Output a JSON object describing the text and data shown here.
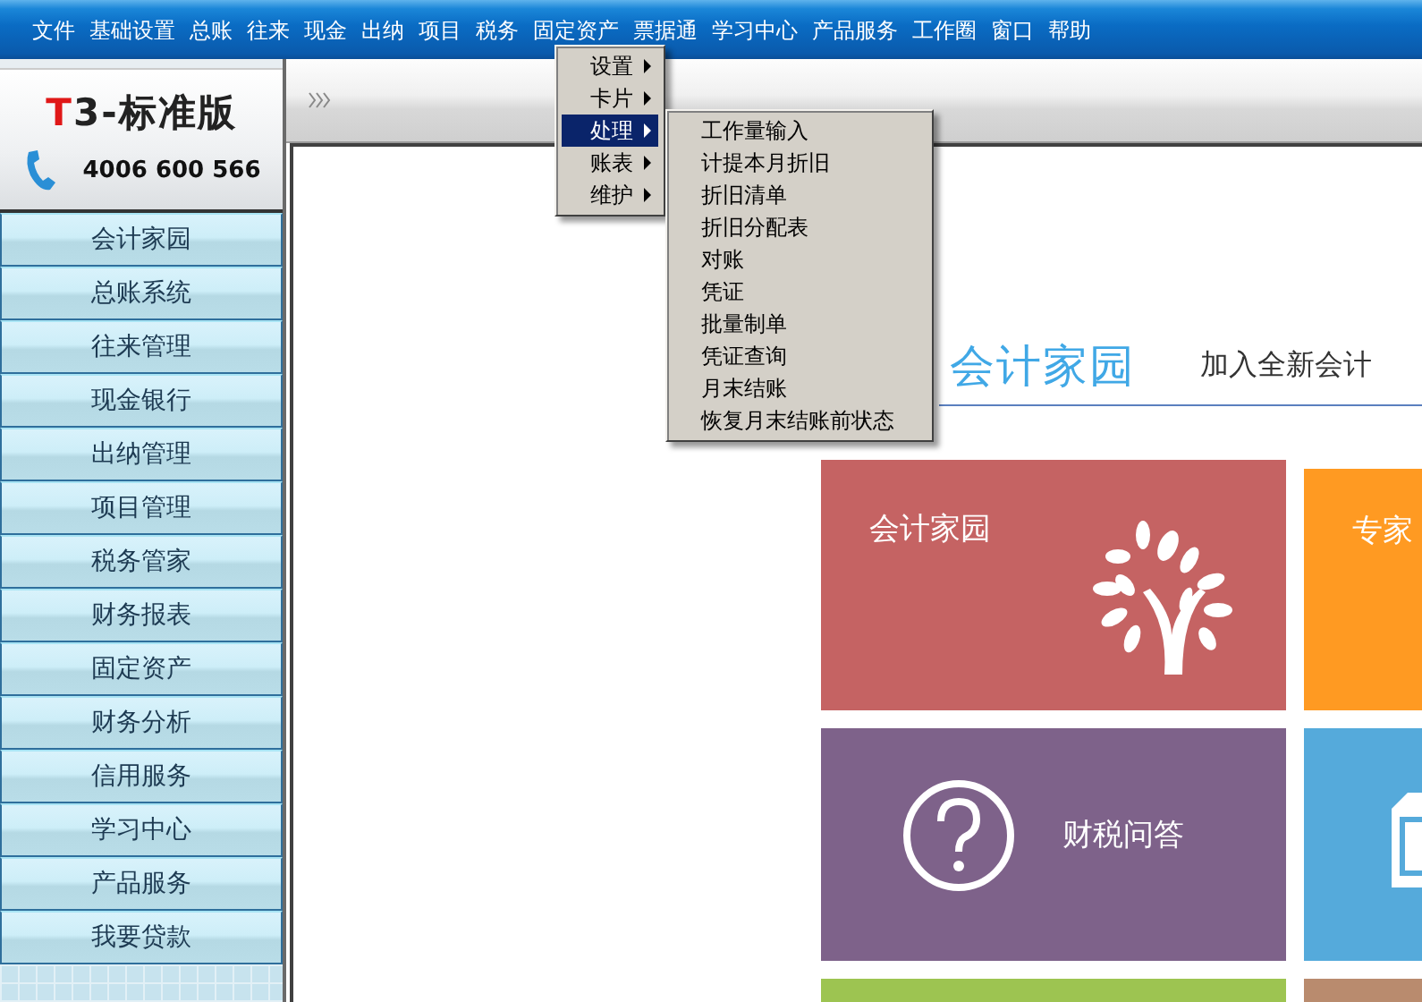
{
  "menubar": [
    "文件",
    "基础设置",
    "总账",
    "往来",
    "现金",
    "出纳",
    "项目",
    "税务",
    "固定资产",
    "票据通",
    "学习中心",
    "产品服务",
    "工作圈",
    "窗口",
    "帮助"
  ],
  "context_menu": {
    "items": [
      {
        "label": "设置",
        "submenu": true,
        "selected": false
      },
      {
        "label": "卡片",
        "submenu": true,
        "selected": false
      },
      {
        "label": "处理",
        "submenu": true,
        "selected": true
      },
      {
        "label": "账表",
        "submenu": true,
        "selected": false
      },
      {
        "label": "维护",
        "submenu": true,
        "selected": false
      }
    ]
  },
  "submenu": {
    "items": [
      {
        "label": "工作量输入",
        "submenu": false,
        "selected": false
      },
      {
        "label": "计提本月折旧",
        "submenu": false,
        "selected": false
      },
      {
        "label": "折旧清单",
        "submenu": false,
        "selected": false
      },
      {
        "label": "折旧分配表",
        "submenu": false,
        "selected": false
      },
      {
        "label": "对账",
        "submenu": false,
        "selected": false
      },
      {
        "label": "凭证",
        "submenu": false,
        "selected": false
      },
      {
        "label": "批量制单",
        "submenu": false,
        "selected": false
      },
      {
        "label": "凭证查询",
        "submenu": false,
        "selected": false
      },
      {
        "label": "月末结账",
        "submenu": false,
        "selected": false
      },
      {
        "label": "恢复月末结账前状态",
        "submenu": false,
        "selected": false
      }
    ]
  },
  "sidebar": {
    "logo": "T3-标准版",
    "phone": "4006 600 566",
    "items": [
      "会计家园",
      "总账系统",
      "往来管理",
      "现金银行",
      "出纳管理",
      "项目管理",
      "税务管家",
      "财务报表",
      "固定资产",
      "财务分析",
      "信用服务",
      "学习中心",
      "产品服务",
      "我要贷款"
    ]
  },
  "home": {
    "logo": "会计家园",
    "tagline": "加入全新会计",
    "tiles": [
      {
        "kind": "tree",
        "label": "会计家园",
        "color": "#c56363"
      },
      {
        "kind": "text",
        "label": "专家",
        "color": "#ff9a22"
      },
      {
        "kind": "question",
        "label": "财税问答",
        "color": "#7e628a"
      },
      {
        "kind": "device",
        "color": "#55aadb"
      },
      {
        "kind": "blank",
        "color": "#9dc451"
      },
      {
        "kind": "blank",
        "color": "#b98b6e"
      }
    ]
  }
}
